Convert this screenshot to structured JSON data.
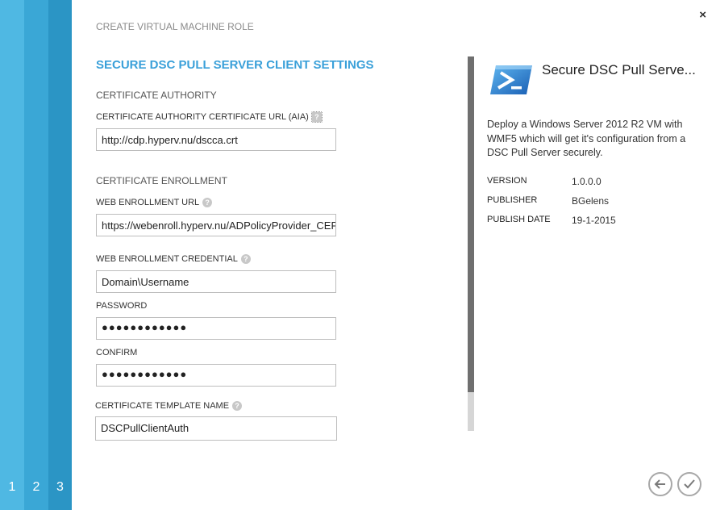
{
  "wizard": {
    "steps": [
      "1",
      "2",
      "3"
    ],
    "dialog_title": "CREATE VIRTUAL MACHINE ROLE",
    "close_glyph": "×"
  },
  "form": {
    "section_title": "SECURE DSC PULL SERVER CLIENT SETTINGS",
    "ca_group": "CERTIFICATE AUTHORITY",
    "ca_url_label": "CERTIFICATE AUTHORITY CERTIFICATE URL (AIA)",
    "ca_url_value": "http://cdp.hyperv.nu/dscca.crt",
    "enroll_group": "CERTIFICATE ENROLLMENT",
    "web_enroll_url_label": "WEB ENROLLMENT URL",
    "web_enroll_url_value": "https://webenroll.hyperv.nu/ADPolicyProvider_CEP",
    "credential_label": "WEB ENROLLMENT CREDENTIAL",
    "credential_value": "Domain\\Username",
    "password_label": "PASSWORD",
    "password_value": "●●●●●●●●●●●●",
    "confirm_label": "CONFIRM",
    "confirm_value": "●●●●●●●●●●●●",
    "template_label": "CERTIFICATE TEMPLATE NAME",
    "template_value": "DSCPullClientAuth"
  },
  "details": {
    "title": "Secure DSC Pull Serve...",
    "icon": "powershell-icon",
    "description": "Deploy a Windows Server 2012 R2 VM with WMF5 which will get it's configuration from a DSC Pull Server securely.",
    "version_label": "VERSION",
    "version_value": "1.0.0.0",
    "publisher_label": "PUBLISHER",
    "publisher_value": "BGelens",
    "publish_date_label": "PUBLISH DATE",
    "publish_date_value": "19-1-2015"
  },
  "colors": {
    "accent": "#3aa0d9",
    "step1": "#4fb8e3",
    "step2": "#3aa7d6",
    "step3": "#2b95c5"
  }
}
